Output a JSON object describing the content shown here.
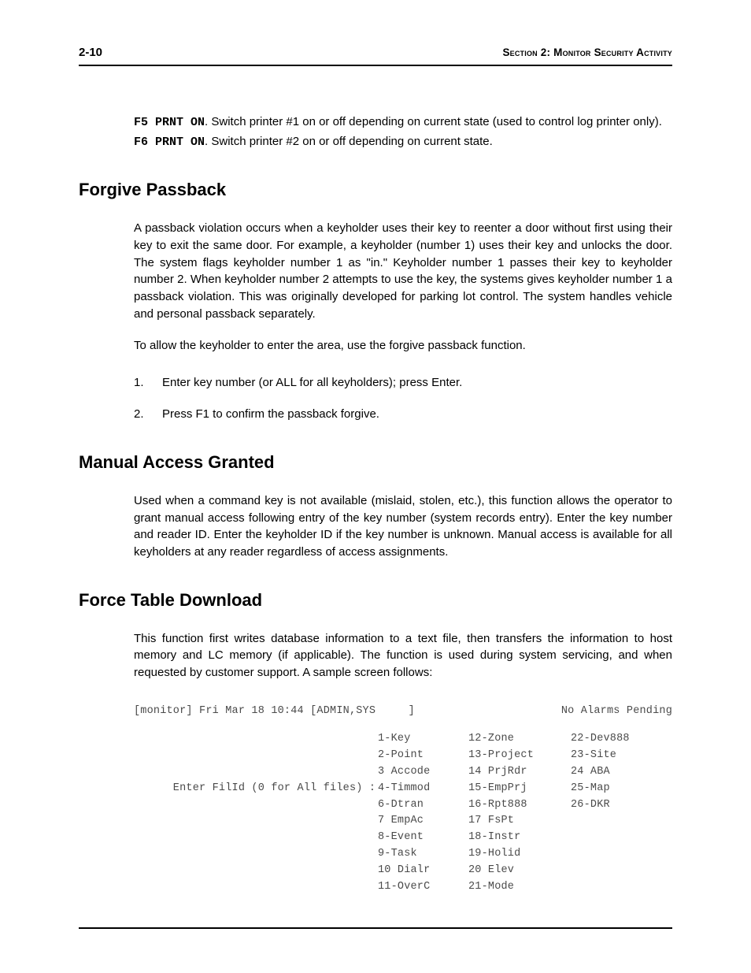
{
  "header": {
    "page_num": "2-10",
    "section": "Section 2: Monitor Security Activity"
  },
  "intro": {
    "f5_key": "F5 PRNT ON",
    "f5_text": ". Switch printer #1 on or off depending on current state (used to control log printer only).",
    "f6_key": "F6 PRNT ON",
    "f6_text": ".  Switch printer #2 on or off depending on current state."
  },
  "forgive": {
    "heading": "Forgive Passback",
    "p1": "A passback violation occurs when a keyholder uses their key to reenter a door without first using their key to exit the same door. For example, a keyholder (number 1) uses their key and unlocks the door. The system flags keyholder number 1 as \"in.\" Keyholder number 1 passes their key to keyholder number 2. When keyholder number 2 attempts to use the key, the systems gives keyholder number 1 a passback violation. This was originally developed for parking lot control. The system handles vehicle and personal passback separately.",
    "p2": "To allow the keyholder to enter the area, use the forgive passback function.",
    "step1": "Enter key number (or ALL for all keyholders); press Enter.",
    "step2": "Press F1 to confirm the passback forgive."
  },
  "manual": {
    "heading": "Manual Access Granted",
    "p1": "Used when a command key is not available (mislaid, stolen, etc.), this function allows the operator to grant manual access following entry of the key number (system records entry).  Enter the key number and reader ID.  Enter the keyholder ID if the key number is unknown.  Manual access is available for all keyholders at any reader regardless of access assignments."
  },
  "force": {
    "heading": "Force Table Download",
    "p1": "This function first writes database information to a text file, then transfers the information to host memory and LC memory (if applicable).  The function is used during system servicing,  and  when requested  by customer support.  A sample screen follows:"
  },
  "terminal": {
    "header_left": "[monitor] Fri Mar 18 10:44 [ADMIN,SYS     ]",
    "header_right": "No Alarms Pending",
    "prompt": "Enter FilId (0 for All files) :",
    "col1": [
      "1-Key",
      "2-Point",
      "3 Accode",
      "4-Timmod",
      "6-Dtran",
      "7 EmpAc",
      "8-Event",
      "9-Task",
      "10 Dialr",
      "11-OverC"
    ],
    "col2": [
      "12-Zone",
      "13-Project",
      "14 PrjRdr",
      "15-EmpPrj",
      "16-Rpt888",
      "17 FsPt",
      "18-Instr",
      "19-Holid",
      "20 Elev",
      "21-Mode"
    ],
    "col3": [
      "22-Dev888",
      "23-Site",
      "24 ABA",
      "25-Map",
      "26-DKR",
      "",
      "",
      "",
      "",
      ""
    ]
  }
}
